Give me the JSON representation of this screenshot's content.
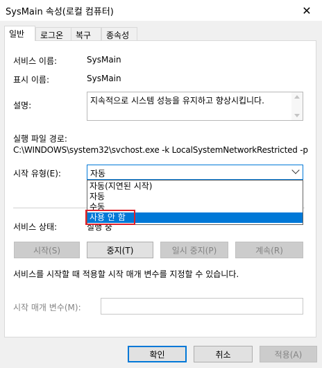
{
  "window": {
    "title": "SysMain 속성(로컬 컴퓨터)",
    "close_glyph": "✕"
  },
  "tabs": [
    {
      "label": "일반",
      "active": true
    },
    {
      "label": "로그온",
      "active": false
    },
    {
      "label": "복구",
      "active": false
    },
    {
      "label": "종속성",
      "active": false
    }
  ],
  "general": {
    "service_name_label": "서비스 이름:",
    "service_name_value": "SysMain",
    "display_name_label": "표시 이름:",
    "display_name_value": "SysMain",
    "description_label": "설명:",
    "description_value": "지속적으로 시스템 성능을 유지하고 향상시킵니다.",
    "exe_path_label": "실행 파일 경로:",
    "exe_path_value": "C:\\WINDOWS\\system32\\svchost.exe -k LocalSystemNetworkRestricted -p",
    "startup_type_label": "시작 유형(E):",
    "startup_type_value": "자동",
    "startup_options": [
      "자동(지연된 시작)",
      "자동",
      "수동",
      "사용 안 함"
    ],
    "startup_highlighted": "사용 안 함",
    "service_status_label": "서비스 상태:",
    "service_status_value": "실행 중",
    "buttons": {
      "start": "시작(S)",
      "stop": "중지(T)",
      "pause": "일시 중지(P)",
      "resume": "계속(R)"
    },
    "hint": "서비스를 시작할 때 적용할 시작 매개 변수를 지정할 수 있습니다.",
    "start_params_label": "시작 매개 변수(M):",
    "start_params_value": ""
  },
  "footer": {
    "ok": "확인",
    "cancel": "취소",
    "apply": "적용(A)"
  },
  "colors": {
    "accent": "#0078d7",
    "highlight_border": "#e0202a"
  }
}
